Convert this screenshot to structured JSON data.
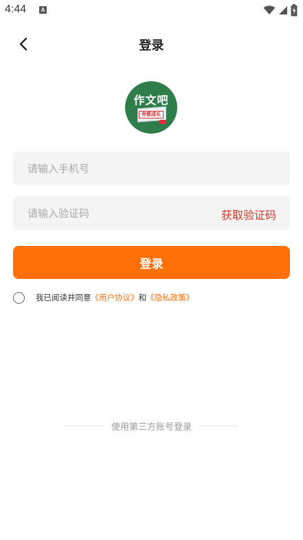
{
  "status_bar": {
    "time": "4:44",
    "notification_badge": "A"
  },
  "header": {
    "title": "登录"
  },
  "logo": {
    "title": "作文吧",
    "stamp": "帝都成长"
  },
  "form": {
    "phone_placeholder": "请输入手机号",
    "phone_value": "",
    "code_placeholder": "请输入验证码",
    "code_value": "",
    "get_code_label": "获取验证码",
    "login_label": "登录"
  },
  "agreement": {
    "checked": false,
    "prefix": "我已阅读并同意",
    "user_agreement": "《用户协议》",
    "conjunction": "和",
    "privacy_policy": "《隐私政策》"
  },
  "third_party": {
    "label": "使用第三方账号登录"
  },
  "colors": {
    "accent": "#ff7008",
    "get_code": "#cf3a2e",
    "logo_bg": "#2f7d4a",
    "input_bg": "#f4f4f4"
  },
  "icons": [
    "wifi-icon",
    "signal-icon",
    "battery-icon",
    "back-arrow-icon"
  ]
}
